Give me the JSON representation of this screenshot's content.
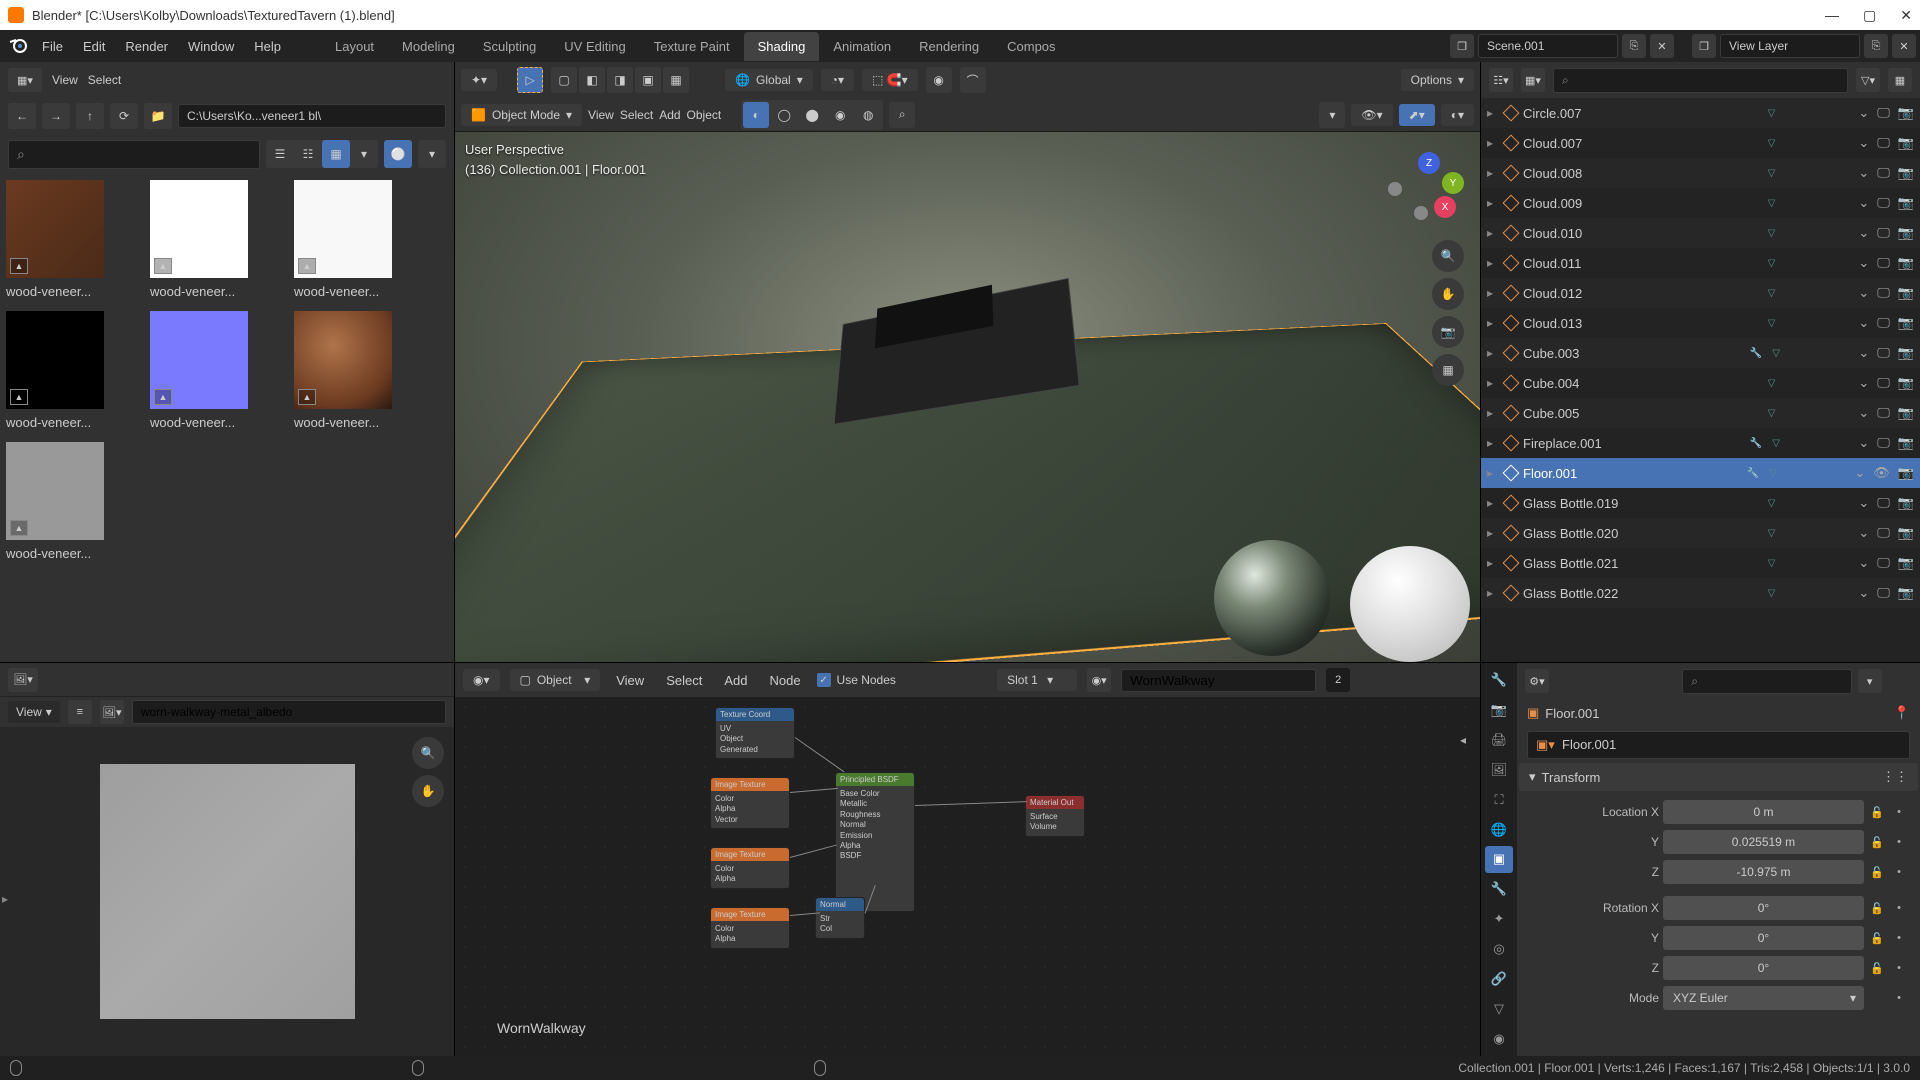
{
  "window": {
    "title": "Blender* [C:\\Users\\Kolby\\Downloads\\TexturedTavern (1).blend]"
  },
  "topmenu": [
    "File",
    "Edit",
    "Render",
    "Window",
    "Help"
  ],
  "workspaces": [
    "Layout",
    "Modeling",
    "Sculpting",
    "UV Editing",
    "Texture Paint",
    "Shading",
    "Animation",
    "Rendering",
    "Compos"
  ],
  "active_workspace": "Shading",
  "scene_name": "Scene.001",
  "view_layer": "View Layer",
  "filebrowser": {
    "menus": [
      "View",
      "Select"
    ],
    "path": "C:\\Users\\Ko...veneer1 bl\\",
    "thumbs": [
      {
        "label": "wood-veneer...",
        "bg": "linear-gradient(135deg,#6b3a20,#4a2a18)"
      },
      {
        "label": "wood-veneer...",
        "bg": "#fff"
      },
      {
        "label": "wood-veneer...",
        "bg": "#f8f8f8"
      },
      {
        "label": "wood-veneer...",
        "bg": "#000"
      },
      {
        "label": "wood-veneer...",
        "bg": "#7a7aff"
      },
      {
        "label": "wood-veneer...",
        "bg": "radial-gradient(circle at 40% 35%,#b0744a 0%,#6b3a20 70%,#2a1810 100%)"
      },
      {
        "label": "wood-veneer...",
        "bg": "#999"
      }
    ]
  },
  "image_editor": {
    "menu_view": "View",
    "image_name": "worn-walkway-metal_albedo"
  },
  "viewport": {
    "header": {
      "orientation": "Global",
      "options": "Options"
    },
    "mode": "Object Mode",
    "menus": [
      "View",
      "Select",
      "Add",
      "Object"
    ],
    "overlay_line1": "User Perspective",
    "overlay_line2": "(136) Collection.001 | Floor.001"
  },
  "node_editor": {
    "obj_label": "Object",
    "menus": [
      "View",
      "Select",
      "Add",
      "Node"
    ],
    "use_nodes": "Use Nodes",
    "slot": "Slot 1",
    "material": "WornWalkway",
    "mat_users": "2",
    "footer_label": "WornWalkway"
  },
  "outliner": [
    {
      "name": "Circle.007"
    },
    {
      "name": "Cloud.007"
    },
    {
      "name": "Cloud.008"
    },
    {
      "name": "Cloud.009"
    },
    {
      "name": "Cloud.010"
    },
    {
      "name": "Cloud.011"
    },
    {
      "name": "Cloud.012"
    },
    {
      "name": "Cloud.013"
    },
    {
      "name": "Cube.003",
      "mod": true
    },
    {
      "name": "Cube.004"
    },
    {
      "name": "Cube.005"
    },
    {
      "name": "Fireplace.001",
      "mod": true
    },
    {
      "name": "Floor.001",
      "sel": true,
      "mod": true
    },
    {
      "name": "Glass Bottle.019"
    },
    {
      "name": "Glass Bottle.020"
    },
    {
      "name": "Glass Bottle.021"
    },
    {
      "name": "Glass Bottle.022"
    }
  ],
  "properties": {
    "object_name": "Floor.001",
    "datablock_name": "Floor.001",
    "panel_transform": "Transform",
    "loc_label": "Location X",
    "loc_x": "0 m",
    "loc_y": "0.025519 m",
    "loc_z": "-10.975 m",
    "rot_label": "Rotation X",
    "rot_x": "0°",
    "rot_y": "0°",
    "rot_z": "0°",
    "y_label": "Y",
    "z_label": "Z",
    "mode_label": "Mode",
    "mode_value": "XYZ Euler"
  },
  "statusbar": {
    "right": "Collection.001 | Floor.001 | Verts:1,246 | Faces:1,167 | Tris:2,458 | Objects:1/1 | 3.0.0"
  }
}
